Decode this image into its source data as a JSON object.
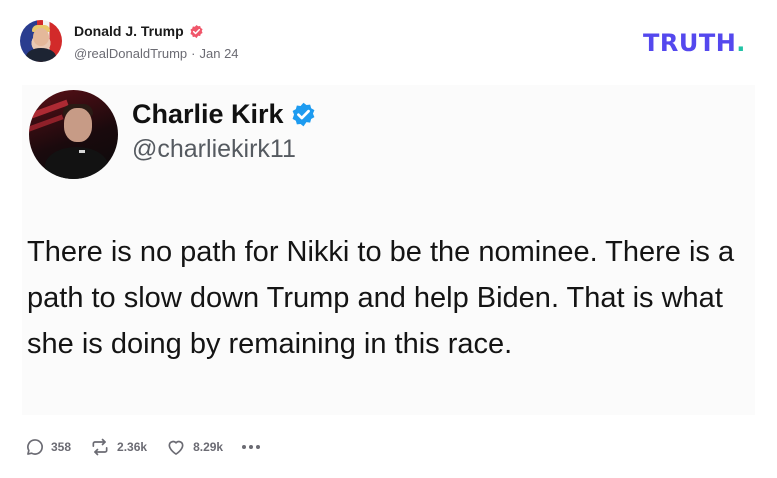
{
  "post": {
    "author_name": "Donald J. Trump",
    "author_handle": "@realDonaldTrump",
    "separator": "·",
    "date": "Jan 24"
  },
  "brand": {
    "logo_text": "TRUTH",
    "logo_dot": ".",
    "logo_color": "#5448ee",
    "dot_color": "#22c3a6"
  },
  "embedded_post": {
    "name": "Charlie Kirk",
    "handle": "@charliekirk11",
    "text": "There is no path for Nikki to be the nominee. There is a path to slow down Trump and help Biden. That is what she is doing by remaining in this race."
  },
  "actions": {
    "replies": "358",
    "retruths": "2.36k",
    "likes": "8.29k"
  },
  "icons": {
    "verified_main": "verified-badge-red",
    "verified_embedded": "verified-badge-blue",
    "reply": "comment-icon",
    "retruth": "repost-icon",
    "like": "heart-icon",
    "more": "ellipsis-icon"
  },
  "colors": {
    "verified_main": "#f0566a",
    "verified_embedded": "#1d9bf0",
    "muted_text": "#6b6b73"
  }
}
